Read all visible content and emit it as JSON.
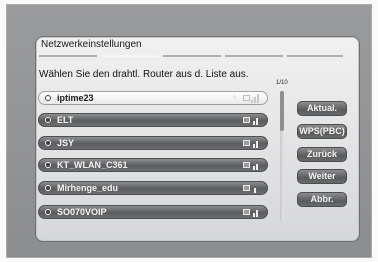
{
  "dialog": {
    "title": "Netzwerkeinstellungen",
    "instruction": "Wählen Sie den drahtl. Router aus d. Liste aus.",
    "page_indicator": "1/10"
  },
  "networks": [
    {
      "ssid": "iptime23",
      "selected": true,
      "wps": true
    },
    {
      "ssid": "ELT",
      "selected": false
    },
    {
      "ssid": "JSY",
      "selected": false
    },
    {
      "ssid": "KT_WLAN_C361",
      "selected": false
    },
    {
      "ssid": "Mirhenge_edu",
      "selected": false
    },
    {
      "ssid": "SO070VOIP",
      "selected": false
    }
  ],
  "buttons": {
    "refresh": "Aktual.",
    "wps": "WPS(PBC)",
    "back": "Zurück",
    "next": "Weiter",
    "cancel": "Abbr."
  },
  "icons": {
    "lock": "lock-icon",
    "signal": "wifi-signal-icon",
    "radio": "radio-icon",
    "wps": "wps-icon"
  }
}
